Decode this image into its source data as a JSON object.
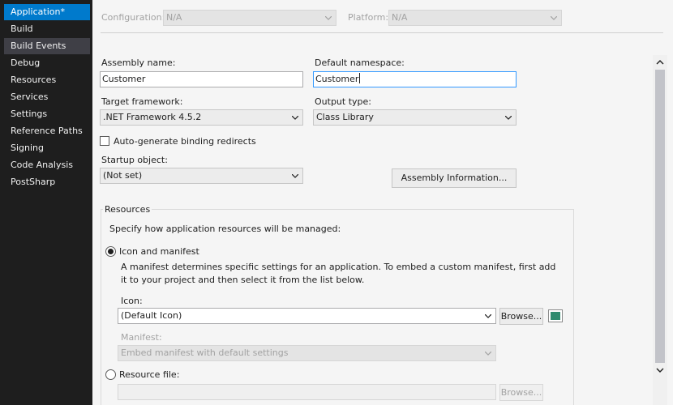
{
  "sidebar": {
    "items": [
      {
        "label": "Application*"
      },
      {
        "label": "Build"
      },
      {
        "label": "Build Events"
      },
      {
        "label": "Debug"
      },
      {
        "label": "Resources"
      },
      {
        "label": "Services"
      },
      {
        "label": "Settings"
      },
      {
        "label": "Reference Paths"
      },
      {
        "label": "Signing"
      },
      {
        "label": "Code Analysis"
      },
      {
        "label": "PostSharp"
      }
    ]
  },
  "toolbar": {
    "configuration_label": "Configuration:",
    "configuration_value": "N/A",
    "platform_label": "Platform:",
    "platform_value": "N/A"
  },
  "form": {
    "assembly_name_label": "Assembly name:",
    "assembly_name_value": "Customer",
    "default_namespace_label": "Default namespace:",
    "default_namespace_value": "Customer",
    "target_framework_label": "Target framework:",
    "target_framework_value": ".NET Framework 4.5.2",
    "output_type_label": "Output type:",
    "output_type_value": "Class Library",
    "auto_binding_label": "Auto-generate binding redirects",
    "startup_object_label": "Startup object:",
    "startup_object_value": "(Not set)",
    "assembly_info_button": "Assembly Information..."
  },
  "resources": {
    "group_title": "Resources",
    "description": "Specify how application resources will be managed:",
    "icon_manifest_label": "Icon and manifest",
    "manifest_help_line1": "A manifest determines specific settings for an application. To embed a custom manifest, first add",
    "manifest_help_line2": "it to your project and then select it from the list below.",
    "icon_label": "Icon:",
    "icon_value": "(Default Icon)",
    "browse_label": "Browse...",
    "manifest_label": "Manifest:",
    "manifest_value": "Embed manifest with default settings",
    "resource_file_label": "Resource file:",
    "browse2_label": "Browse..."
  },
  "colors": {
    "accent": "#007acc",
    "sidebar_bg": "#1e1e1e",
    "panel_bg": "#f5f5f5"
  },
  "icons": {
    "dropdown": "chevron-down-icon",
    "scroll_up": "arrow-up-icon",
    "scroll_down": "arrow-down-icon"
  }
}
